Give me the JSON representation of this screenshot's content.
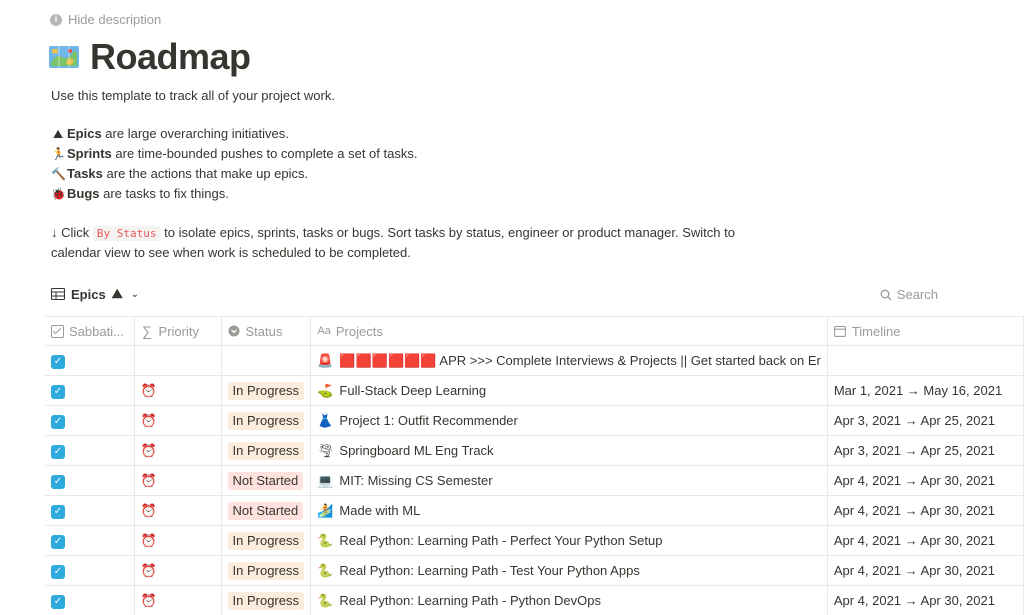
{
  "hide_description": "Hide description",
  "page": {
    "title": "Roadmap",
    "icon": "map-icon"
  },
  "description": {
    "intro": "Use this template to track all of your project work.",
    "defs": [
      {
        "icon": "mountain-icon",
        "glyph": "⛰",
        "term": "Epics",
        "text": " are large overarching initiatives."
      },
      {
        "icon": "runner-icon",
        "glyph": "🏃",
        "term": "Sprints",
        "text": " are time-bounded pushes to complete a set of tasks."
      },
      {
        "icon": "hammer-icon",
        "glyph": "🔨",
        "term": "Tasks",
        "text": " are the actions that make up epics."
      },
      {
        "icon": "bug-icon",
        "glyph": "🐞",
        "term": "Bugs",
        "text": " are tasks to fix things."
      }
    ],
    "click_prefix": "↓ Click",
    "click_code": "By Status",
    "click_suffix": " to isolate epics, sprints, tasks or bugs. Sort tasks by status, engineer or product manager. Switch to",
    "click_line2": "calendar view to see when work is scheduled to be completed."
  },
  "view": {
    "label": "Epics",
    "emoji": "⛰"
  },
  "search": {
    "label": "Search"
  },
  "table": {
    "columns": [
      {
        "label": "Sabbati...",
        "icon": "checkbox-column-icon"
      },
      {
        "label": "Priority",
        "icon": "sigma-icon"
      },
      {
        "label": "Status",
        "icon": "status-column-icon"
      },
      {
        "label": "Projects",
        "icon": "title-column-icon"
      },
      {
        "label": "Timeline",
        "icon": "calendar-icon"
      }
    ],
    "rows": [
      {
        "checked": true,
        "priority": "",
        "status": "",
        "status_type": "",
        "project_icon": "🚨",
        "project": "🟥🟥🟥🟥🟥🟥 APR >>> Complete Interviews & Projects || Get started back on Er",
        "timeline": ""
      },
      {
        "checked": true,
        "priority": "⏰",
        "status": "In Progress",
        "status_type": "progress",
        "project_icon": "⛳",
        "project": "Full-Stack Deep Learning",
        "timeline": "Mar 1, 2021 → May 16, 2021"
      },
      {
        "checked": true,
        "priority": "⏰",
        "status": "In Progress",
        "status_type": "progress",
        "project_icon": "👗",
        "project": "Project 1: Outfit Recommender",
        "timeline": "Apr 3, 2021 → Apr 25, 2021"
      },
      {
        "checked": true,
        "priority": "⏰",
        "status": "In Progress",
        "status_type": "progress",
        "project_icon": "🌪",
        "project": "Springboard ML Eng Track",
        "timeline": "Apr 3, 2021 → Apr 25, 2021"
      },
      {
        "checked": true,
        "priority": "⏰",
        "status": "Not Started",
        "status_type": "notstarted",
        "project_icon": "💻",
        "project": "MIT: Missing CS Semester",
        "timeline": "Apr 4, 2021 → Apr 30, 2021"
      },
      {
        "checked": true,
        "priority": "⏰",
        "status": "Not Started",
        "status_type": "notstarted",
        "project_icon": "🏄",
        "project": "Made with ML",
        "timeline": "Apr 4, 2021 → Apr 30, 2021"
      },
      {
        "checked": true,
        "priority": "⏰",
        "status": "In Progress",
        "status_type": "progress",
        "project_icon": "🐍",
        "project": "Real Python: Learning Path - Perfect Your Python Setup",
        "timeline": "Apr 4, 2021 → Apr 30, 2021"
      },
      {
        "checked": true,
        "priority": "⏰",
        "status": "In Progress",
        "status_type": "progress",
        "project_icon": "🐍",
        "project": "Real Python: Learning Path - Test Your Python Apps",
        "timeline": "Apr 4, 2021 → Apr 30, 2021"
      },
      {
        "checked": true,
        "priority": "⏰",
        "status": "In Progress",
        "status_type": "progress",
        "project_icon": "🐍",
        "project": "Real Python: Learning Path - Python DevOps",
        "timeline": "Apr 4, 2021 → Apr 30, 2021"
      }
    ]
  },
  "colors": {
    "checkbox": "#2eaadc",
    "in_progress_bg": "#fbecdd",
    "not_started_bg": "#ffe2dd",
    "code_text": "#eb5757"
  }
}
